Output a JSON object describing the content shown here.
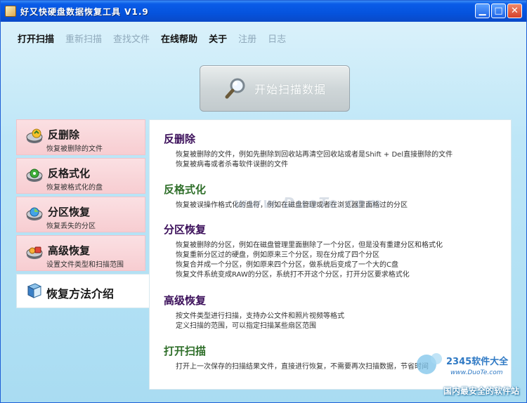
{
  "window": {
    "title": "好又快硬盘数据恢复工具 V1.9",
    "buttons": {
      "minimize": "▁",
      "maximize": "□",
      "close": "✕"
    }
  },
  "menu": {
    "items": [
      {
        "label": "打开扫描",
        "enabled": true
      },
      {
        "label": "重新扫描",
        "enabled": false
      },
      {
        "label": "查找文件",
        "enabled": false
      },
      {
        "label": "在线帮助",
        "enabled": true
      },
      {
        "label": "关于",
        "enabled": true
      },
      {
        "label": "注册",
        "enabled": false
      },
      {
        "label": "日志",
        "enabled": false
      }
    ]
  },
  "scan_button": {
    "label": "开始扫描数据",
    "icon": "magnifier-icon"
  },
  "nav": {
    "items": [
      {
        "title": "反删除",
        "subtitle": "恢复被删除的文件",
        "icon": "disk-recycle-icon"
      },
      {
        "title": "反格式化",
        "subtitle": "恢复被格式化的盘",
        "icon": "disk-green-icon"
      },
      {
        "title": "分区恢复",
        "subtitle": "恢复丢失的分区",
        "icon": "disk-partition-icon"
      },
      {
        "title": "高级恢复",
        "subtitle": "设置文件类型和扫描范围",
        "icon": "disk-advanced-icon"
      },
      {
        "title": "恢复方法介绍",
        "subtitle": "",
        "icon": "book-icon",
        "active": true
      }
    ]
  },
  "content": {
    "sections": [
      {
        "title": "反删除",
        "color": "#3b0f5a",
        "lines": [
          "恢复被删除的文件，例如先删除到回收站再清空回收站或者是Shift + Del直接删除的文件",
          "恢复被病毒或者杀毒软件误删的文件"
        ]
      },
      {
        "title": "反格式化",
        "color": "#2f6f2a",
        "lines": [
          "恢复被误操作格式化的盘符，例如在磁盘管理或者在浏览器里面格过的分区"
        ]
      },
      {
        "title": "分区恢复",
        "color": "#3b0f5a",
        "lines": [
          "恢复被删除的分区，例如在磁盘管理里面删除了一个分区，但是没有重建分区和格式化",
          "恢复重新分区过的硬盘，例如原来三个分区，现在分成了四个分区",
          "恢复合并成一个分区，例如原来四个分区，做系统后变成了一个大的C盘",
          "恢复文件系统变成RAW的分区，系统打不开这个分区，打开分区要求格式化"
        ]
      },
      {
        "title": "高级恢复",
        "color": "#3b0f5a",
        "lines": [
          "按文件类型进行扫描，支持办公文件和照片视频等格式",
          "定义扫描的范围，可以指定扫描某些扇区范围"
        ]
      },
      {
        "title": "打开扫描",
        "color": "#2f6f2a",
        "lines": [
          "打开上一次保存的扫描结果文件，直接进行恢复，不需要再次扫描数据，节省时间"
        ]
      }
    ]
  },
  "watermark": {
    "center_text": "www.DuoTe.com",
    "corner_brand": "2345软件大全",
    "corner_url": "www.DuoTe.com",
    "corner_tagline": "国内最安全的软件站"
  }
}
